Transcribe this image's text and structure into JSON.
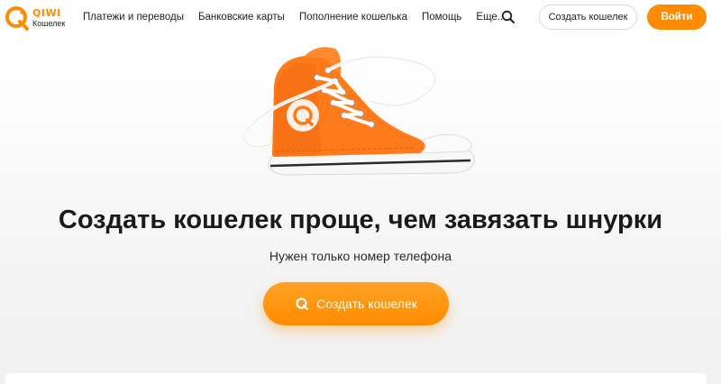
{
  "logo": {
    "brand": "QIWI",
    "sub": "Кошелек",
    "icon": "qiwi-logo-icon"
  },
  "nav": {
    "items": [
      {
        "label": "Платежи и переводы"
      },
      {
        "label": "Банковские карты"
      },
      {
        "label": "Пополнение кошелька"
      },
      {
        "label": "Помощь"
      },
      {
        "label": "Еще..."
      }
    ],
    "search_icon": "search-icon"
  },
  "header": {
    "create_label": "Создать кошелек",
    "login_label": "Войти"
  },
  "hero": {
    "image": "orange-sneaker",
    "title": "Создать кошелек проще, чем завязать шнурки",
    "subtitle": "Нужен только номер телефона",
    "button_label": "Создать кошелек",
    "button_icon": "qiwi-q-icon"
  },
  "colors": {
    "accent": "#ff8c00",
    "text": "#1f1f1f"
  }
}
